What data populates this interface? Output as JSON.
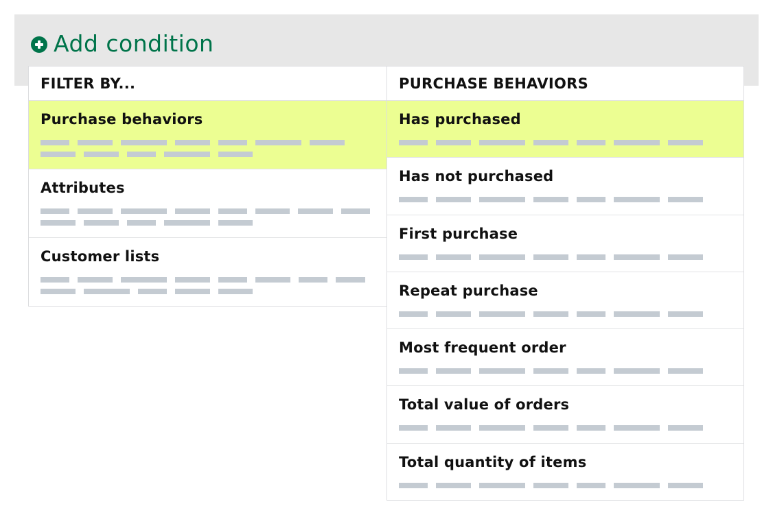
{
  "add_condition": {
    "label": "Add condition",
    "icon": "plus-circle-icon",
    "color": "#00744a"
  },
  "filter_panel": {
    "header": "FILTER BY...",
    "items": [
      {
        "label": "Purchase behaviors",
        "selected": true,
        "placeholder_lines": [
          [
            42,
            51,
            67,
            51,
            42,
            67,
            51
          ],
          [
            51,
            51,
            42,
            67,
            50
          ]
        ]
      },
      {
        "label": "Attributes",
        "selected": false,
        "placeholder_lines": [
          [
            42,
            51,
            67,
            51,
            42,
            50,
            51,
            42
          ],
          [
            51,
            51,
            42,
            67,
            50
          ]
        ]
      },
      {
        "label": "Customer lists",
        "selected": false,
        "placeholder_lines": [
          [
            42,
            51,
            67,
            51,
            42,
            51,
            42,
            43
          ],
          [
            51,
            67,
            42,
            51,
            50
          ]
        ]
      }
    ]
  },
  "behaviors_panel": {
    "header": "PURCHASE BEHAVIORS",
    "items": [
      {
        "label": "Has purchased",
        "selected": true,
        "placeholder_lines": [
          [
            42,
            51,
            67,
            51,
            42,
            67,
            51
          ]
        ]
      },
      {
        "label": "Has not purchased",
        "selected": false,
        "placeholder_lines": [
          [
            42,
            51,
            67,
            51,
            42,
            67,
            51
          ]
        ]
      },
      {
        "label": "First purchase",
        "selected": false,
        "placeholder_lines": [
          [
            42,
            51,
            67,
            51,
            42,
            67,
            51
          ]
        ]
      },
      {
        "label": "Repeat purchase",
        "selected": false,
        "placeholder_lines": [
          [
            42,
            51,
            67,
            51,
            42,
            67,
            51
          ]
        ]
      },
      {
        "label": "Most frequent order",
        "selected": false,
        "placeholder_lines": [
          [
            42,
            51,
            67,
            51,
            42,
            67,
            51
          ]
        ]
      },
      {
        "label": "Total value of orders",
        "selected": false,
        "placeholder_lines": [
          [
            42,
            51,
            67,
            51,
            42,
            67,
            51
          ]
        ]
      },
      {
        "label": "Total quantity of items",
        "selected": false,
        "placeholder_lines": [
          [
            42,
            51,
            67,
            51,
            42,
            67,
            51
          ]
        ]
      }
    ]
  },
  "colors": {
    "selected_row": "#ecfe92",
    "placeholder_bar": "#c4cbd2",
    "banner": "#e7e7e7"
  }
}
